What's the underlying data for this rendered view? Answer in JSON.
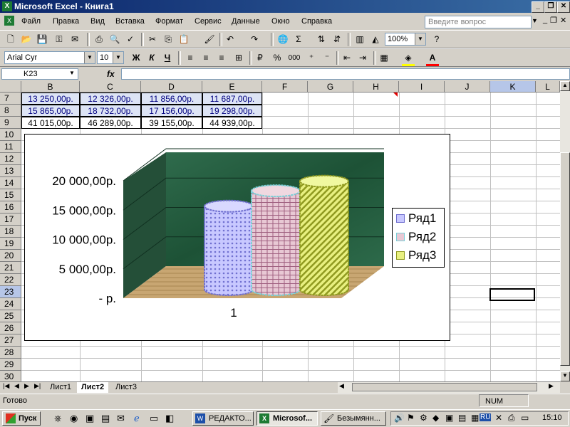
{
  "window": {
    "title": "Microsoft Excel - Книга1"
  },
  "menu": {
    "items": [
      "Файл",
      "Правка",
      "Вид",
      "Вставка",
      "Формат",
      "Сервис",
      "Данные",
      "Окно",
      "Справка"
    ],
    "help_placeholder": "Введите вопрос"
  },
  "toolbar": {
    "zoom": "100%",
    "font": "Arial Cyr",
    "font_size": "10",
    "bold": "Ж",
    "italic": "К",
    "underline": "Ч",
    "percent": "%",
    "thousands": "000"
  },
  "formula_bar": {
    "name_box": "K23",
    "fx": "fx",
    "value": ""
  },
  "columns": [
    "B",
    "C",
    "D",
    "E",
    "F",
    "G",
    "H",
    "I",
    "J",
    "K",
    "L"
  ],
  "rows": [
    "7",
    "8",
    "9",
    "10",
    "11",
    "12",
    "13",
    "14",
    "15",
    "16",
    "17",
    "18",
    "19",
    "20",
    "21",
    "22",
    "23",
    "24",
    "25",
    "26",
    "27",
    "28",
    "29",
    "30"
  ],
  "table": [
    [
      "13 250,00р.",
      "12 326,00р.",
      "11 856,00р.",
      "11 687,00р."
    ],
    [
      "15 865,00р.",
      "18 732,00р.",
      "17 156,00р.",
      "19 298,00р."
    ],
    [
      "41 015,00р.",
      "46 289,00р.",
      "39 155,00р.",
      "44 939,00р."
    ]
  ],
  "chart_data": {
    "type": "bar",
    "categories": [
      "1"
    ],
    "series": [
      {
        "name": "Ряд1",
        "values": [
          13250
        ]
      },
      {
        "name": "Ряд2",
        "values": [
          15865
        ]
      },
      {
        "name": "Ряд3",
        "values": [
          17500
        ]
      }
    ],
    "ytick_labels": [
      "20 000,00р.",
      "15 000,00р.",
      "10 000,00р.",
      "5 000,00р.",
      "-   р."
    ],
    "ylim": [
      0,
      20000
    ],
    "legend": "right",
    "colors": {
      "Ряд1": "#9999ff",
      "Ряд2": "#e0b0c0",
      "Ряд3": "#d8e060"
    }
  },
  "sheets": {
    "tabs": [
      "Лист1",
      "Лист2",
      "Лист3"
    ],
    "active": "Лист2"
  },
  "status": {
    "left": "Готово",
    "num": "NUM"
  },
  "taskbar": {
    "start": "Пуск",
    "buttons": [
      "РЕДАКТО...",
      "Microsof...",
      "Безымянн..."
    ],
    "active": "Microsof...",
    "clock": "15:10",
    "lang": "RU"
  }
}
